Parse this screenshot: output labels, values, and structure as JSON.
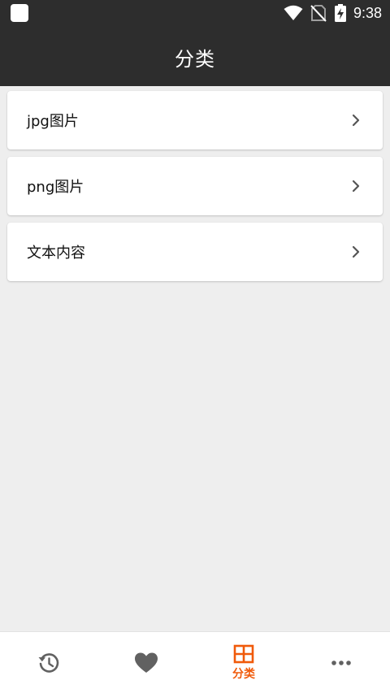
{
  "status_bar": {
    "time": "9:38",
    "icons": [
      "app-notification-icon",
      "wifi-icon",
      "no-sim-icon",
      "battery-charging-icon"
    ]
  },
  "title_bar": {
    "title": "分类"
  },
  "categories": [
    {
      "label": "jpg图片",
      "icon": "chevron-right-icon"
    },
    {
      "label": "png图片",
      "icon": "chevron-right-icon"
    },
    {
      "label": "文本内容",
      "icon": "chevron-right-icon"
    }
  ],
  "bottom_nav": {
    "tabs": [
      {
        "icon": "history-icon",
        "label": "",
        "active": false
      },
      {
        "icon": "heart-icon",
        "label": "",
        "active": false
      },
      {
        "icon": "category-grid-icon",
        "label": "分类",
        "active": true
      },
      {
        "icon": "more-icon",
        "label": "",
        "active": false
      }
    ]
  },
  "colors": {
    "header_bg": "#2d2d2d",
    "page_bg": "#eeeeee",
    "accent": "#f05a0a",
    "icon_inactive": "#616161"
  }
}
